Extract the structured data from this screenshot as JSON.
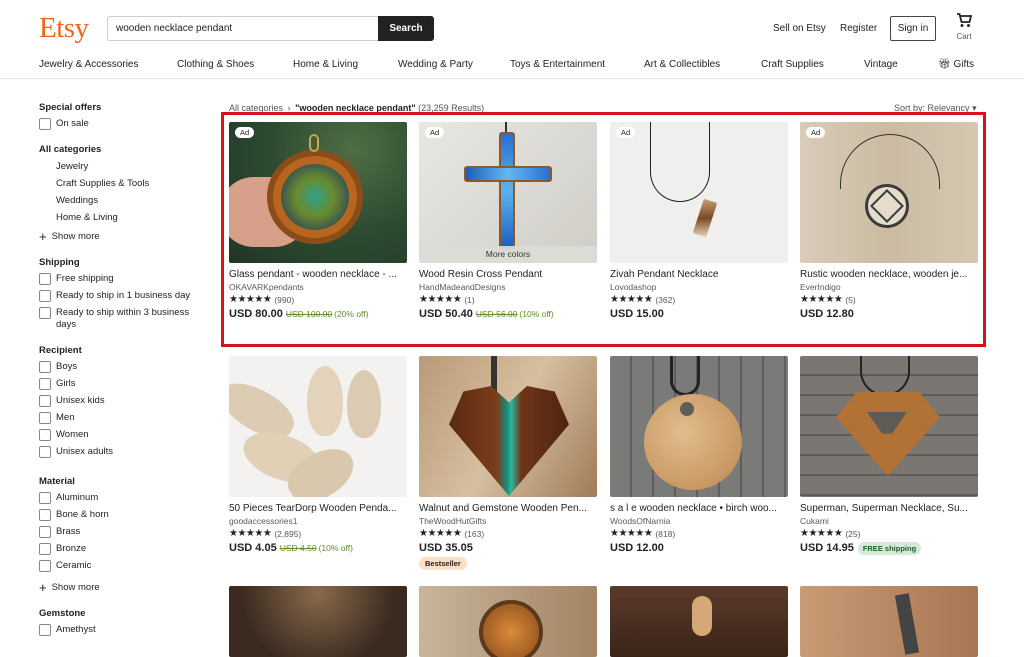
{
  "header": {
    "logo": "Etsy",
    "search_value": "wooden necklace pendant",
    "search_button": "Search",
    "sell_link": "Sell on Etsy",
    "register_link": "Register",
    "signin_button": "Sign in",
    "cart_label": "Cart"
  },
  "categories": [
    "Jewelry & Accessories",
    "Clothing & Shoes",
    "Home & Living",
    "Wedding & Party",
    "Toys & Entertainment",
    "Art & Collectibles",
    "Craft Supplies",
    "Vintage",
    "Gifts"
  ],
  "sidebar": {
    "special_offers": {
      "title": "Special offers",
      "items": [
        "On sale"
      ]
    },
    "all_categories": {
      "title": "All categories",
      "items": [
        "Jewelry",
        "Craft Supplies & Tools",
        "Weddings",
        "Home & Living"
      ],
      "show_more": "Show more"
    },
    "shipping": {
      "title": "Shipping",
      "items": [
        "Free shipping",
        "Ready to ship in 1 business day",
        "Ready to ship within 3 business days"
      ]
    },
    "recipient": {
      "title": "Recipient",
      "items": [
        "Boys",
        "Girls",
        "Unisex kids",
        "Men",
        "Women",
        "Unisex adults"
      ]
    },
    "material": {
      "title": "Material",
      "items": [
        "Aluminum",
        "Bone & horn",
        "Brass",
        "Bronze",
        "Ceramic"
      ],
      "show_more": "Show more"
    },
    "gemstone": {
      "title": "Gemstone",
      "items": [
        "Amethyst"
      ]
    }
  },
  "results": {
    "breadcrumb_root": "All categories",
    "breadcrumb_sep": "›",
    "query_label": "\"wooden necklace pendant\"",
    "count": "(23,259 Results)",
    "sort_label": "Sort by: Relevancy"
  },
  "listings": [
    {
      "title": "Glass pendant - wooden necklace - ...",
      "shop": "OKAVARKpendants",
      "stars": "★★★★★",
      "reviews": "(990)",
      "price": "USD 80.00",
      "orig_price": "USD 100.00",
      "discount": "(20% off)",
      "ad": "Ad"
    },
    {
      "title": "Wood Resin Cross Pendant",
      "shop": "HandMadeandDesigns",
      "stars": "★★★★★",
      "reviews": "(1)",
      "price": "USD 50.40",
      "orig_price": "USD 56.00",
      "discount": "(10% off)",
      "ad": "Ad",
      "more_colors": "More colors"
    },
    {
      "title": "Zivah Pendant Necklace",
      "shop": "Lovodashop",
      "stars": "★★★★★",
      "reviews": "(362)",
      "price": "USD 15.00",
      "ad": "Ad"
    },
    {
      "title": "Rustic wooden necklace, wooden je...",
      "shop": "EverIndigo",
      "stars": "★★★★★",
      "reviews": "(5)",
      "price": "USD 12.80",
      "ad": "Ad"
    },
    {
      "title": "50 Pieces TearDorp Wooden Penda...",
      "shop": "goodaccessories1",
      "stars": "★★★★★",
      "reviews": "(2,895)",
      "price": "USD 4.05",
      "orig_price": "USD 4.50",
      "discount": "(10% off)"
    },
    {
      "title": "Walnut and Gemstone Wooden Pen...",
      "shop": "TheWoodHutGifts",
      "stars": "★★★★★",
      "reviews": "(163)",
      "price": "USD 35.05",
      "badge": "Bestseller"
    },
    {
      "title": "s a l e wooden necklace • birch woo...",
      "shop": "WoodsOfNarnia",
      "stars": "★★★★★",
      "reviews": "(818)",
      "price": "USD 12.00"
    },
    {
      "title": "Superman, Superman Necklace, Su...",
      "shop": "Cukami",
      "stars": "★★★★★",
      "reviews": "(25)",
      "price": "USD 14.95",
      "shipping_badge": "FREE shipping"
    }
  ],
  "colors": {
    "brand": "#f1641e",
    "highlight": "#d9111b",
    "sale_green": "#5e8c2e"
  }
}
